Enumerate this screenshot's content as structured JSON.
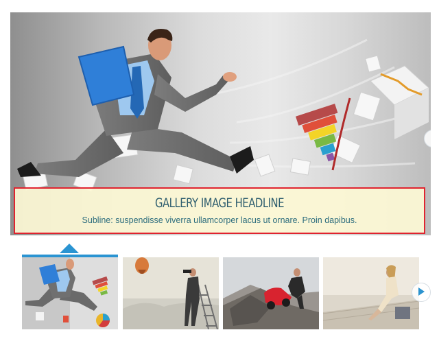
{
  "main_slide": {
    "image": "businessman-running-with-folder-and-charts",
    "next_icon": "arrow-right-icon"
  },
  "caption": {
    "title": "GALLERY IMAGE HEADLINE",
    "subtitle": "Subline: suspendisse viverra ullamcorper lacus ut ornare. Proin dapibus."
  },
  "thumbnails": [
    {
      "image": "businessman-running-with-charts",
      "active": true
    },
    {
      "image": "man-on-ladder-with-binoculars",
      "active": false
    },
    {
      "image": "businessman-pushing-red-car-uphill",
      "active": false
    },
    {
      "image": "woman-sitting-on-pier",
      "active": false
    }
  ],
  "thumb_next_icon": "arrow-right-icon",
  "colors": {
    "accent": "#2a94d2",
    "caption_border": "#e0232f",
    "caption_bg": "#fcf7d4",
    "caption_text": "#2d5d6e"
  }
}
